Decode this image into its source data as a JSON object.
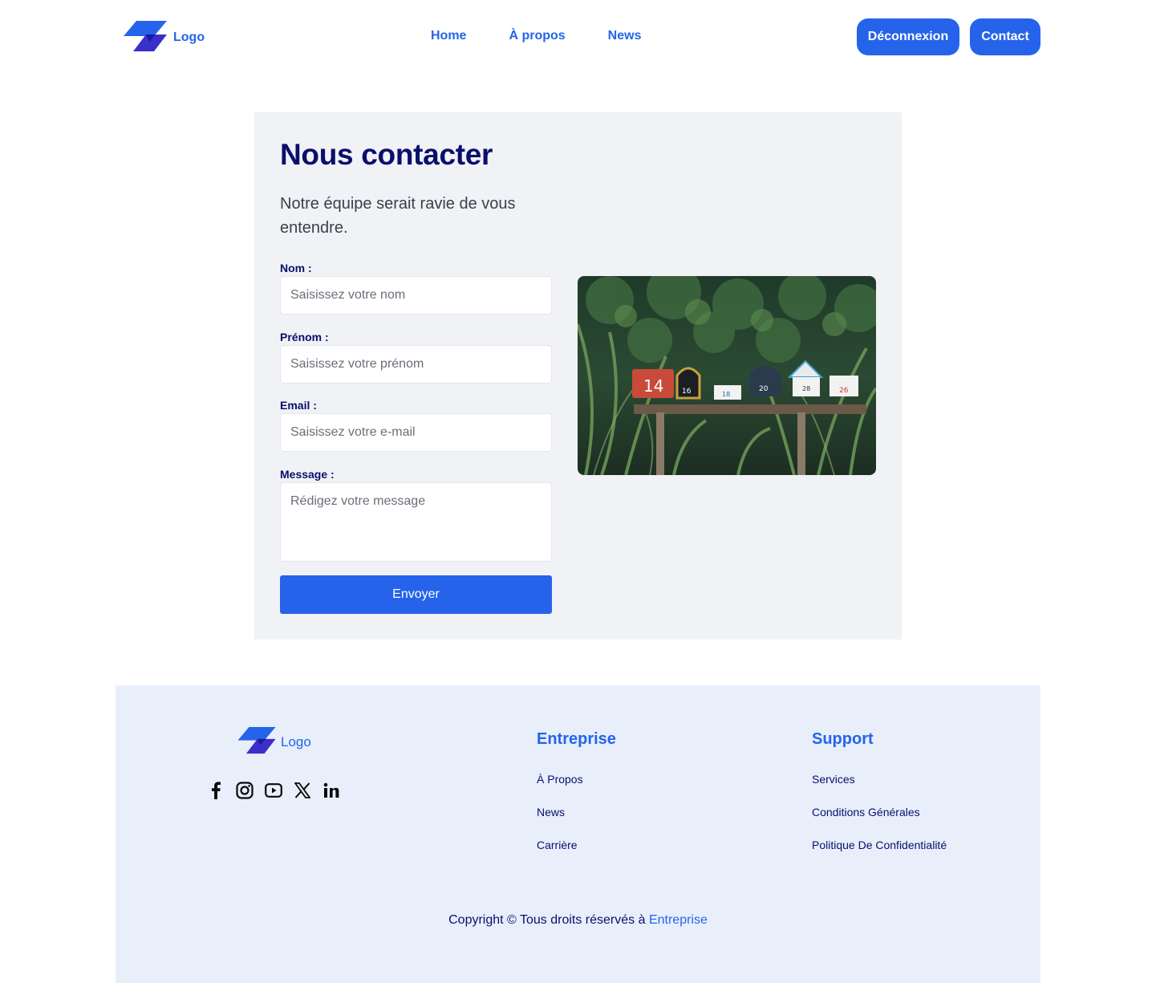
{
  "brand": {
    "logo_text": "Logo"
  },
  "nav": {
    "items": [
      "Home",
      "À propos",
      "News"
    ]
  },
  "header_buttons": {
    "logout": "Déconnexion",
    "contact": "Contact"
  },
  "contact": {
    "title": "Nous contacter",
    "subtitle": "Notre équipe serait ravie de vous entendre.",
    "fields": {
      "nom": {
        "label": "Nom :",
        "placeholder": "Saisissez votre nom"
      },
      "prenom": {
        "label": "Prénom :",
        "placeholder": "Saisissez votre prénom"
      },
      "email": {
        "label": "Email :",
        "placeholder": "Saisissez votre e-mail"
      },
      "message": {
        "label": "Message :",
        "placeholder": "Rédigez votre message"
      }
    },
    "submit": "Envoyer"
  },
  "photo": {
    "mailbox_numbers": [
      "14",
      "16",
      "18",
      "20",
      "28",
      "26"
    ]
  },
  "footer": {
    "logo_text": "Logo",
    "socials": [
      "facebook-icon",
      "instagram-icon",
      "youtube-icon",
      "x-icon",
      "linkedin-icon"
    ],
    "entreprise": {
      "title": "Entreprise",
      "links": [
        "À Propos",
        "News",
        "Carrière"
      ]
    },
    "support": {
      "title": "Support",
      "links": [
        "Services",
        "Conditions Générales",
        "Politique De Confidentialité"
      ]
    },
    "copyright_prefix": "Copyright © Tous droits réservés à",
    "copyright_link": "Entreprise"
  },
  "colors": {
    "accent": "#2563eb",
    "navy": "#0a0f6b",
    "card_bg": "#f0f2f5",
    "footer_bg": "#e8effb"
  }
}
